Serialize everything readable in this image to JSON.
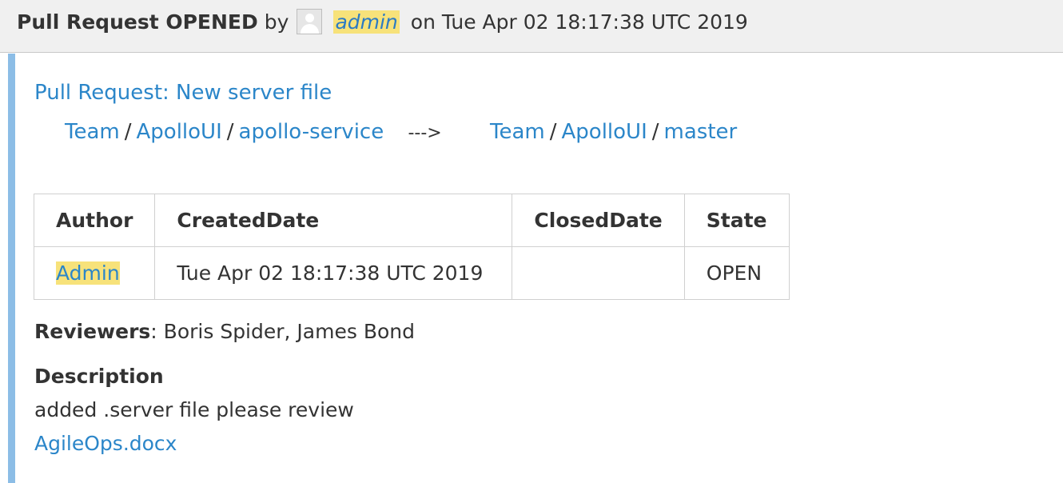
{
  "header": {
    "event": "Pull Request OPENED",
    "by": "by",
    "user": "admin",
    "date": "on Tue Apr 02 18:17:38 UTC 2019"
  },
  "pull_request": {
    "title": "Pull Request: New server file",
    "source": {
      "project": "Team",
      "repo": "ApolloUI",
      "branch": "apollo-service"
    },
    "arrow": "--->",
    "target": {
      "project": "Team",
      "repo": "ApolloUI",
      "branch": "master"
    },
    "separator": "/"
  },
  "table": {
    "headers": [
      "Author",
      "CreatedDate",
      "ClosedDate",
      "State"
    ],
    "row": {
      "author": "Admin",
      "created": "Tue Apr 02 18:17:38 UTC 2019",
      "closed": "",
      "state": "OPEN"
    }
  },
  "reviewers": {
    "label": "Reviewers",
    "colon": ":",
    "names": " Boris Spider, James Bond"
  },
  "description": {
    "label": "Description",
    "text": "added .server file please review",
    "attachment": "AgileOps.docx"
  },
  "colors": {
    "link": "#2b86c9",
    "highlight": "#f7e27a",
    "accent_bar": "#8cbde6",
    "header_bg": "#f0f0f0"
  },
  "icons": {
    "avatar": "user-avatar-icon"
  }
}
